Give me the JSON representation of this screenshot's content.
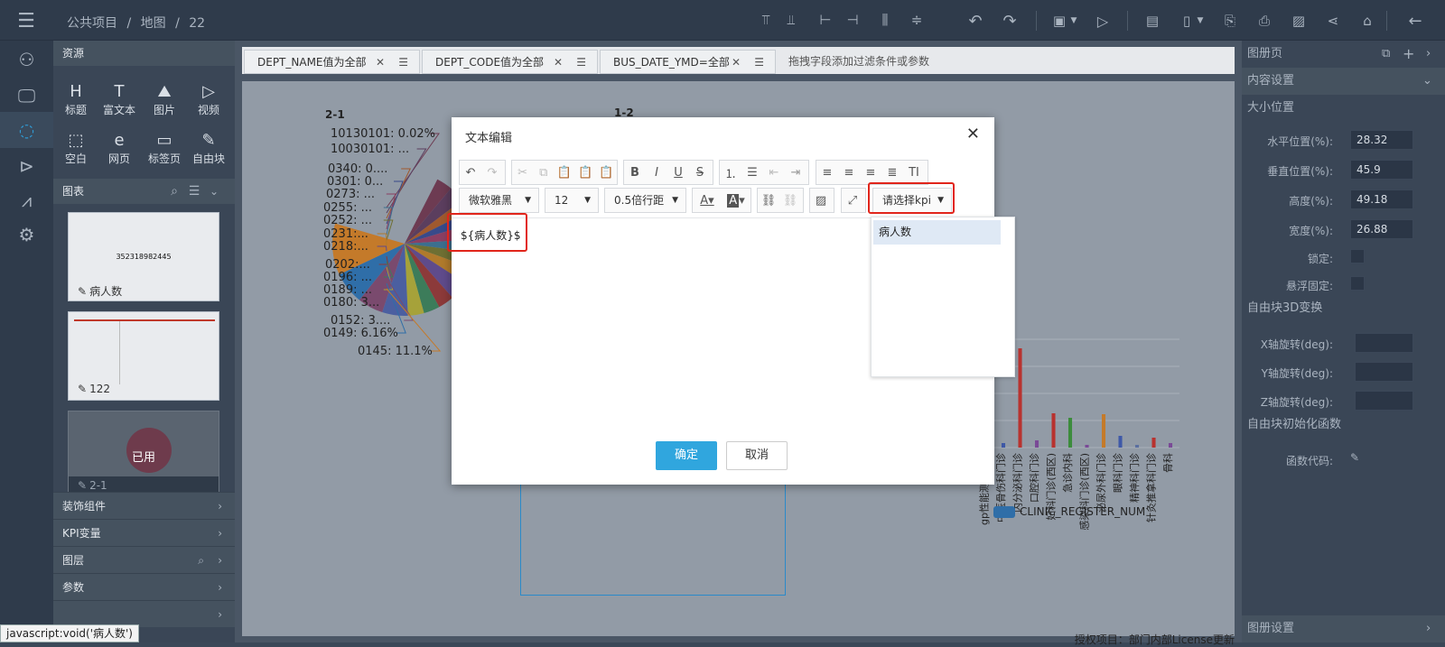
{
  "topbar": {
    "breadcrumb": [
      "公共项目",
      "地图",
      "22"
    ],
    "separator": "/"
  },
  "leftnav": {
    "icons": [
      "user-icon",
      "monitor-icon",
      "loading-icon",
      "play-icon",
      "line-chart-icon",
      "settings-icon"
    ]
  },
  "sidebar": {
    "resources_title": "资源",
    "resources": [
      {
        "glyph": "H",
        "label": "标题"
      },
      {
        "glyph": "T",
        "label": "富文本"
      },
      {
        "glyph": "⛰",
        "label": "图片"
      },
      {
        "glyph": "▷",
        "label": "视频"
      },
      {
        "glyph": "⬚",
        "label": "空白"
      },
      {
        "glyph": "e",
        "label": "网页"
      },
      {
        "glyph": "▭",
        "label": "标签页"
      },
      {
        "glyph": "✎",
        "label": "自由块"
      }
    ],
    "charts_title": "图表",
    "card1_value": "352318982445",
    "card1_label": "病人数",
    "card2_label": "122",
    "card3_badge": "已用",
    "card3_label": "2-1",
    "accordions": [
      "装饰组件",
      "KPI变量",
      "图层",
      "参数",
      ""
    ]
  },
  "filters": {
    "tabs": [
      "DEPT_NAME值为全部",
      "DEPT_CODE值为全部",
      "BUS_DATE_YMD=全部"
    ],
    "hint": "拖拽字段添加过滤条件或参数"
  },
  "canvas": {
    "pie_title": "2-1",
    "pie_labels": [
      "10130101: 0.02%",
      "10030101: ...",
      "0340: 0....",
      "0301: 0...",
      "0273: ...",
      "0255: ...",
      "0252: ...",
      "0231:...",
      "0218:...",
      "0202:...",
      "0196: ...",
      "0189: ...",
      "0180: 3...",
      "0152: 3....",
      "0149: 6.16%",
      "0145: 11.1%"
    ],
    "center_title": "1-2",
    "bar_categories": [
      "gp性能测试科一",
      "中医骨伤科门诊",
      "内分泌科门诊",
      "口腔科门诊",
      "妇科门诊(西区)",
      "急诊内科",
      "感染科门诊(西区)",
      "泌尿外科门诊",
      "眼科门诊",
      "精神科门诊",
      "针灸推拿科门诊",
      "骨科"
    ],
    "legend": "CLINIC_REGISTER_NUM",
    "footer": "授权项目：部门内部License更新"
  },
  "right_panel": {
    "title": "图册页",
    "content_settings": "内容设置",
    "size_position": "大小位置",
    "fields": [
      {
        "label": "水平位置(%):",
        "value": "28.32"
      },
      {
        "label": "垂直位置(%):",
        "value": "45.9"
      },
      {
        "label": "高度(%):",
        "value": "49.18"
      },
      {
        "label": "宽度(%):",
        "value": "26.88"
      }
    ],
    "lock_label": "锁定:",
    "float_label": "悬浮固定:",
    "transform3d": "自由块3D变换",
    "rotations": [
      "X轴旋转(deg):",
      "Y轴旋转(deg):",
      "Z轴旋转(deg):"
    ],
    "init_func": "自由块初始化函数",
    "func_code": "函数代码:",
    "album_settings": "图册设置"
  },
  "dialog": {
    "title": "文本编辑",
    "font": "微软雅黑",
    "size": "12",
    "line_spacing": "0.5倍行距",
    "kpi_select": "请选择kpi",
    "content": "${病人数}$",
    "kpi_option": "病人数",
    "confirm": "确定",
    "cancel": "取消"
  },
  "status_bar": "javascript:void('病人数')",
  "chart_data": {
    "type": "bar",
    "categories": [
      "gp性能测试科一",
      "中医骨伤科门诊",
      "内分泌科门诊",
      "口腔科门诊",
      "妇科门诊(西区)",
      "急诊内科",
      "感染科门诊(西区)",
      "泌尿外科门诊",
      "眼科门诊",
      "精神科门诊",
      "针灸推拿科门诊",
      "骨科"
    ],
    "values": [
      20,
      5,
      110,
      8,
      38,
      33,
      3,
      37,
      13,
      3,
      11,
      5
    ],
    "legend": "CLINIC_REGISTER_NUM"
  }
}
